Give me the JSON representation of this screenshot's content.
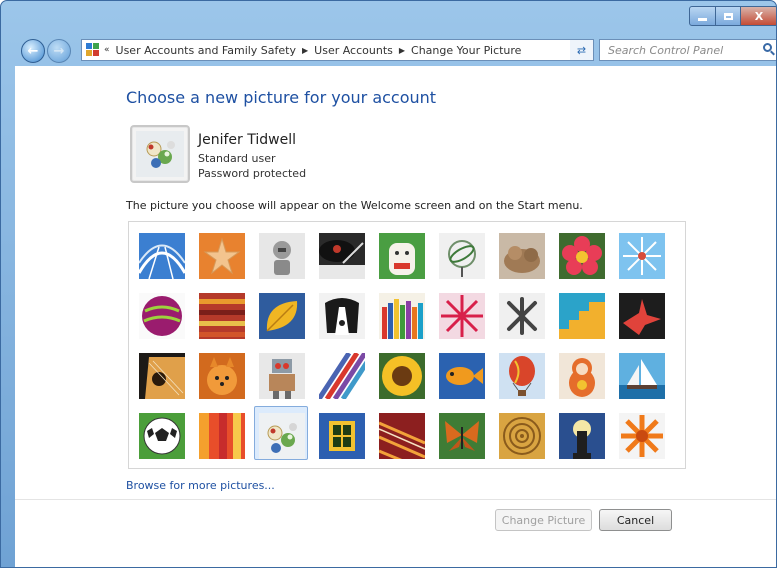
{
  "window": {
    "buttons": {
      "minimize": "minimize",
      "maximize": "maximize",
      "close": "X"
    }
  },
  "navigation": {
    "breadcrumb": [
      "User Accounts and Family Safety",
      "User Accounts",
      "Change Your Picture"
    ],
    "search_placeholder": "Search Control Panel"
  },
  "page": {
    "heading": "Choose a new picture for your account",
    "user": {
      "name": "Jenifer Tidwell",
      "account_type": "Standard user",
      "password_status": "Password protected"
    },
    "description": "The picture you choose will appear on the Welcome screen and on the Start menu.",
    "pictures": [
      "roller-coaster",
      "starfish",
      "robot-figure",
      "record-player",
      "lucky-cat",
      "gyroscope",
      "kitten",
      "red-flower",
      "pinwheel",
      "magenta-ball",
      "fabric-stripes",
      "yellow-leaf",
      "border-collie",
      "crayons",
      "red-fireworks-flower",
      "jacks",
      "blue-stairs",
      "paper-crane",
      "guitar",
      "pomeranian",
      "toy-robot",
      "striped-fabric",
      "sunflower",
      "orange-fish",
      "hot-air-balloon",
      "matryoshka",
      "sailboat",
      "soccer-ball",
      "red-orange-fabric",
      "marbles",
      "window",
      "embroidered-fabric",
      "butterfly",
      "shell-spiral",
      "lighthouse",
      "orange-gerbera"
    ],
    "selected_picture": "marbles",
    "browse_link": "Browse for more pictures...",
    "buttons": {
      "change_picture": "Change Picture",
      "cancel": "Cancel"
    }
  }
}
